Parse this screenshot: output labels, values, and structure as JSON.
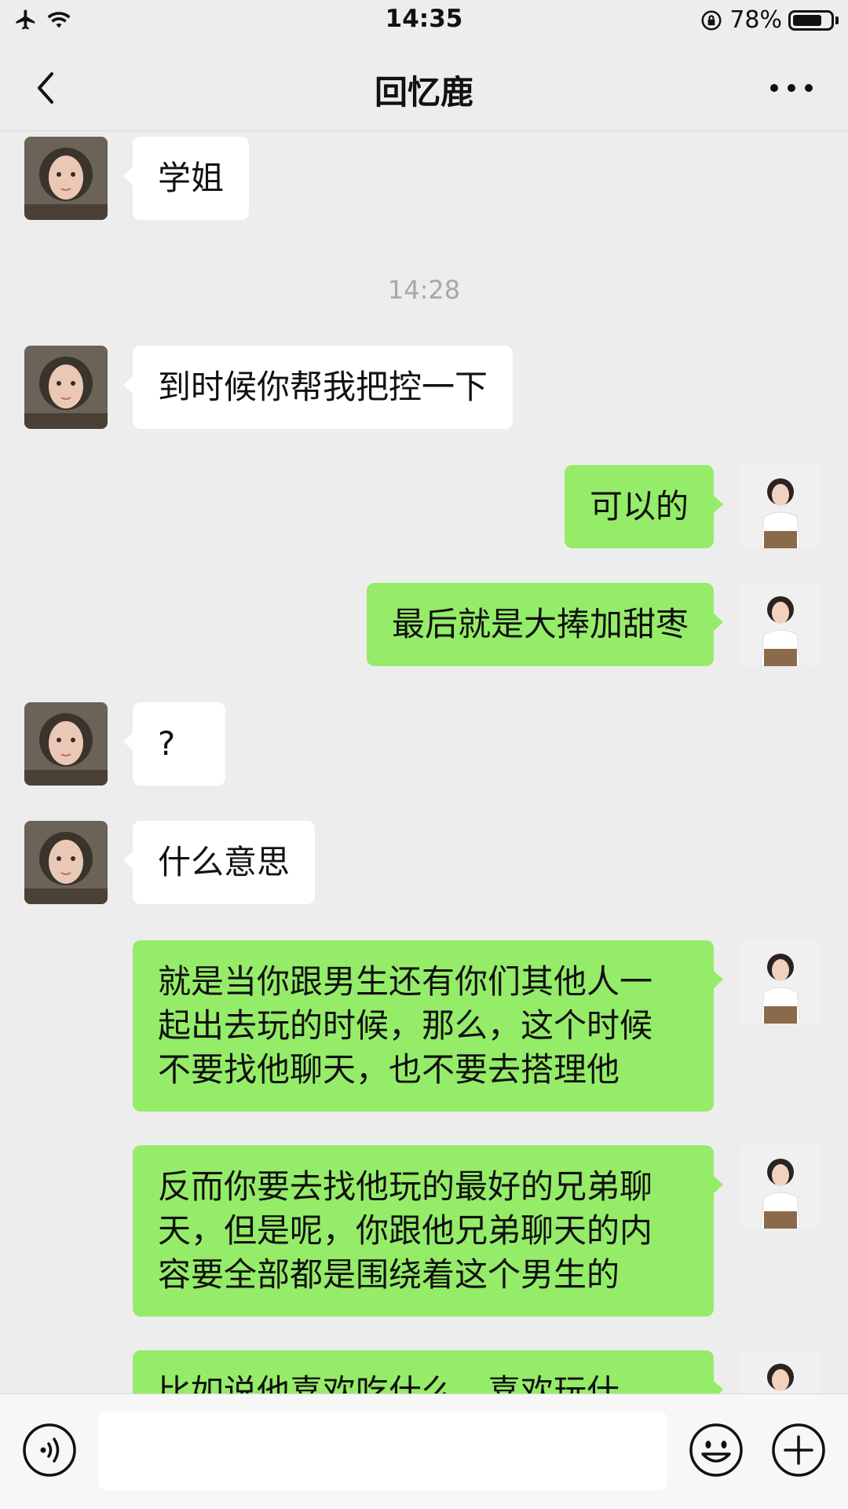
{
  "status_bar": {
    "time": "14:35",
    "battery_percent_text": "78%",
    "battery_level": 0.78,
    "icons": [
      "airplane-icon",
      "wifi-icon",
      "orientation-lock-icon",
      "battery-icon"
    ]
  },
  "nav": {
    "title": "回忆鹿",
    "back_icon": "chevron-left-icon",
    "more_icon": "more-dots-icon"
  },
  "messages": [
    {
      "from": "them",
      "text": "学姐"
    },
    {
      "timestamp": "14:28"
    },
    {
      "from": "them",
      "text": "到时候你帮我把控一下"
    },
    {
      "from": "me",
      "text": "可以的"
    },
    {
      "from": "me",
      "text": "最后就是大捧加甜枣"
    },
    {
      "from": "them",
      "text": "?"
    },
    {
      "from": "them",
      "text": "什么意思"
    },
    {
      "from": "me",
      "lines": [
        "就是当你跟男生还有你们其他人一",
        "起出去玩的时候，那么，这个时候",
        "不要找他聊天，也不要去搭理他"
      ]
    },
    {
      "from": "me",
      "lines": [
        "反而你要去找他玩的最好的兄弟聊",
        "天，但是呢，你跟他兄弟聊天的内",
        "容要全部都是围绕着这个男生的"
      ]
    },
    {
      "from": "me",
      "lines": [
        "比如说他喜欢吃什么，喜欢玩什"
      ]
    }
  ],
  "input_bar": {
    "voice_icon": "voice-icon",
    "emoji_icon": "emoji-icon",
    "plus_icon": "plus-icon",
    "input_value": ""
  },
  "colors": {
    "background": "#ededed",
    "sent_bubble": "#95ec69",
    "received_bubble": "#ffffff",
    "timestamp_text": "#a8a8a8"
  }
}
